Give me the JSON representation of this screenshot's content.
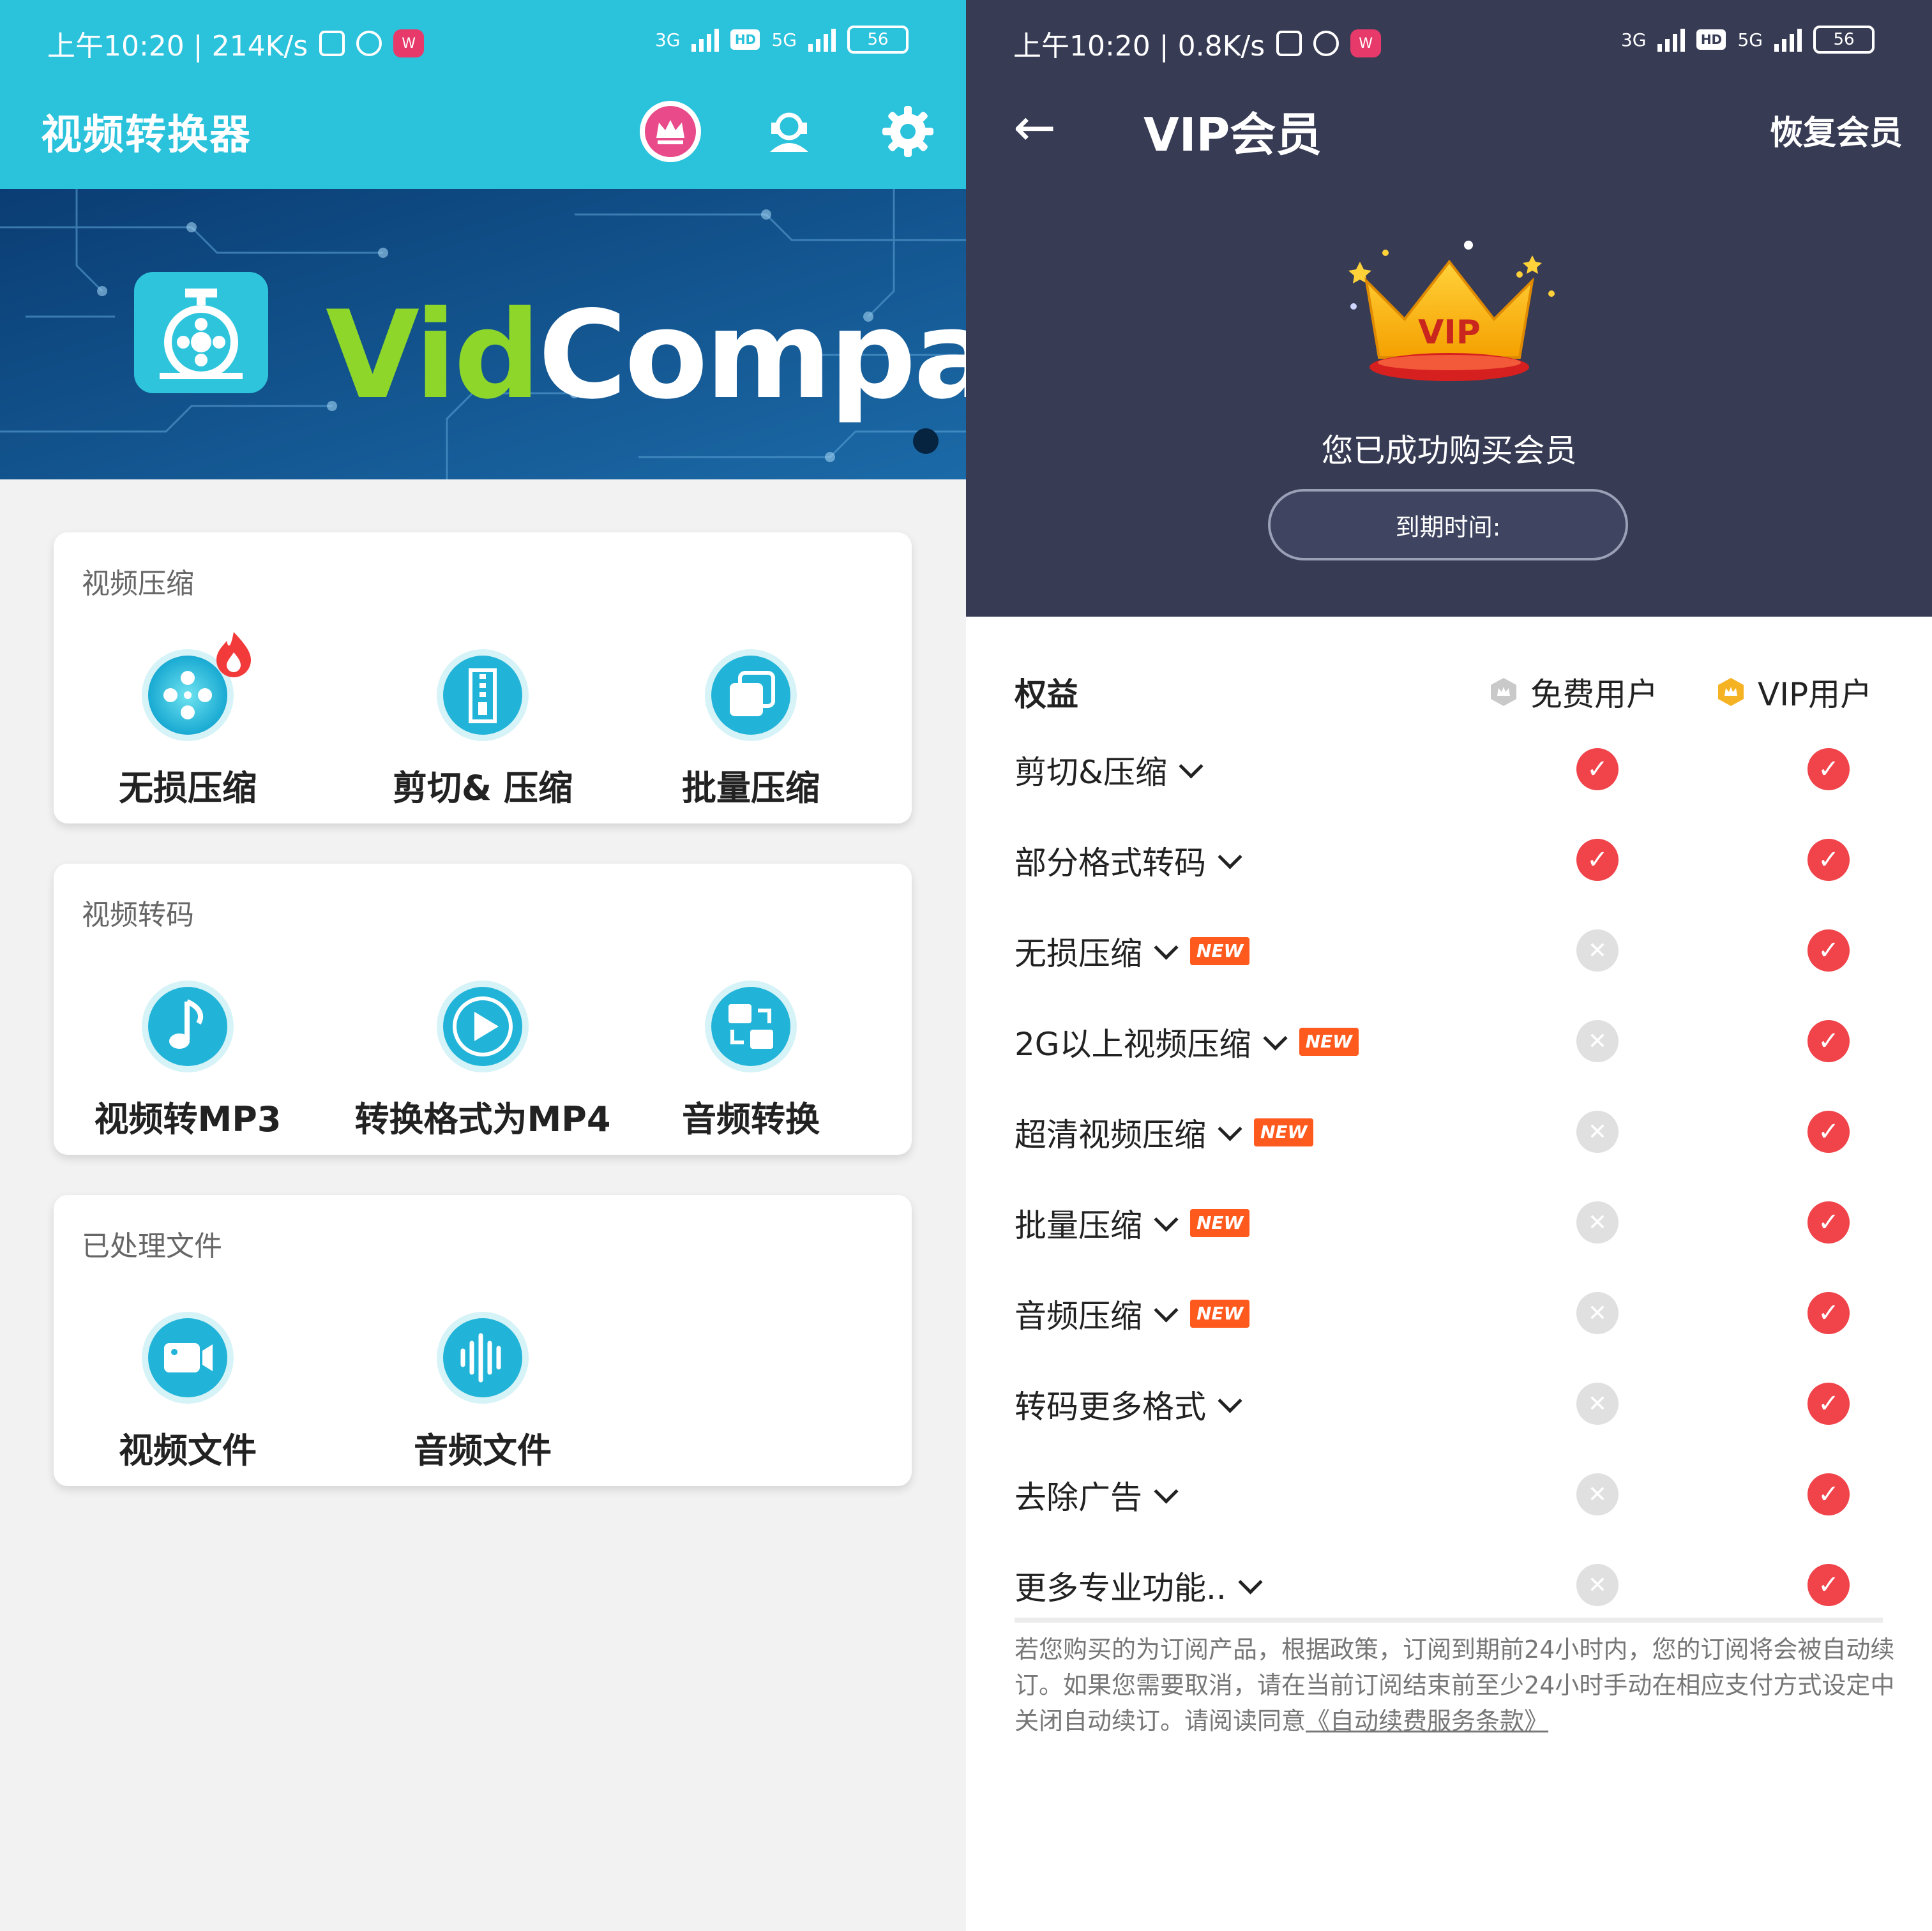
{
  "left": {
    "status": {
      "time": "上午10:20 | 214K/s",
      "net1": "3G",
      "hd": "HD",
      "net2": "5G",
      "battery": "56"
    },
    "header": {
      "title": "视频转换器"
    },
    "banner": {
      "brand_part1": "Vid",
      "brand_part2": "Compact"
    },
    "cards": [
      {
        "title": "视频压缩",
        "items": [
          "无损压缩",
          "剪切& 压缩",
          "批量压缩"
        ]
      },
      {
        "title": "视频转码",
        "items": [
          "视频转MP3",
          "转换格式为MP4",
          "音频转换"
        ]
      },
      {
        "title": "已处理文件",
        "items": [
          "视频文件",
          "音频文件"
        ]
      }
    ],
    "colors": {
      "header": "#2bc2dc",
      "accent": "#2bc2dc"
    }
  },
  "right": {
    "status": {
      "time": "上午10:20 | 0.8K/s",
      "net1": "3G",
      "hd": "HD",
      "net2": "5G",
      "battery": "56"
    },
    "header": {
      "back": "←",
      "title": "VIP会员",
      "restore": "恢复会员"
    },
    "crown_text": "VIP",
    "success": "您已成功购买会员",
    "expire_label": "到期时间:",
    "table": {
      "col_benefit": "权益",
      "col_free": "免费用户",
      "col_vip": "VIP用户",
      "new_badge": "NEW",
      "rows": [
        {
          "label": "剪切&压缩",
          "new": false,
          "free": true,
          "vip": true
        },
        {
          "label": "部分格式转码",
          "new": false,
          "free": true,
          "vip": true
        },
        {
          "label": "无损压缩",
          "new": true,
          "free": false,
          "vip": true
        },
        {
          "label": "2G以上视频压缩",
          "new": true,
          "free": false,
          "vip": true
        },
        {
          "label": "超清视频压缩",
          "new": true,
          "free": false,
          "vip": true
        },
        {
          "label": "批量压缩",
          "new": true,
          "free": false,
          "vip": true
        },
        {
          "label": "音频压缩",
          "new": true,
          "free": false,
          "vip": true
        },
        {
          "label": "转码更多格式",
          "new": false,
          "free": false,
          "vip": true
        },
        {
          "label": "去除广告",
          "new": false,
          "free": false,
          "vip": true
        },
        {
          "label": "更多专业功能..",
          "new": false,
          "free": false,
          "vip": true
        }
      ]
    },
    "notice": "若您购买的为订阅产品，根据政策，订阅到期前24小时内，您的订阅将会被自动续订。如果您需要取消，请在当前订阅结束前至少24小时手动在相应支付方式设定中关闭自动续订。请阅读同意",
    "notice_link": "《自动续费服务条款》",
    "colors": {
      "top_bg": "#373b54",
      "check": "#f0434a",
      "cross": "#e0e0e0",
      "new_badge": "#ff5a1e"
    }
  }
}
